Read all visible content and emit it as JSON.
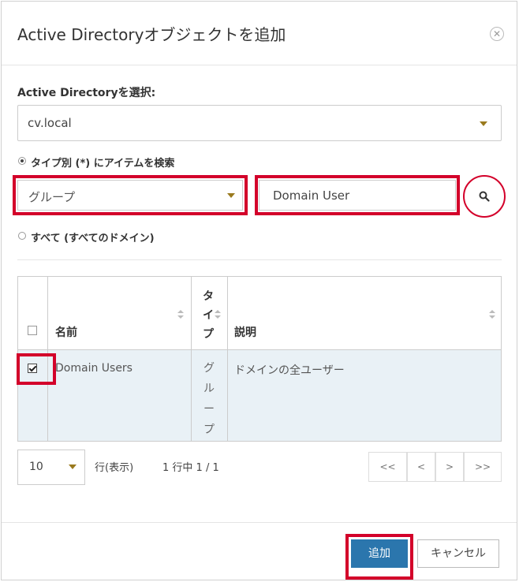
{
  "dialog": {
    "title": "Active Directoryオブジェクトを追加",
    "close_icon": "close-circle-icon"
  },
  "ad_select": {
    "label": "Active Directoryを選択:",
    "value": "cv.local"
  },
  "search_by_type": {
    "label": "タイプ別 (*) にアイテムを検索",
    "selected": true,
    "type_value": "グループ",
    "search_value": "Domain User",
    "search_icon": "search-icon"
  },
  "search_all": {
    "label": "すべて (すべてのドメイン)",
    "selected": false
  },
  "table": {
    "columns": {
      "name": "名前",
      "type_chars": [
        "タ",
        "イ",
        "プ"
      ],
      "description": "説明"
    },
    "rows": [
      {
        "checked": true,
        "name": "Domain Users",
        "type_chars": [
          "グ",
          "ル",
          "ー",
          "プ"
        ],
        "description": "ドメインの全ユーザー"
      }
    ]
  },
  "pager": {
    "page_size": "10",
    "rows_label": "行(表示)",
    "info": "1 行中 1 / 1",
    "buttons": [
      "<<",
      "<",
      ">",
      ">>"
    ]
  },
  "footer": {
    "add_label": "追加",
    "cancel_label": "キャンセル"
  },
  "colors": {
    "highlight": "#d3002a",
    "primary": "#2b76ad",
    "row_selected": "#e9f1f6"
  }
}
